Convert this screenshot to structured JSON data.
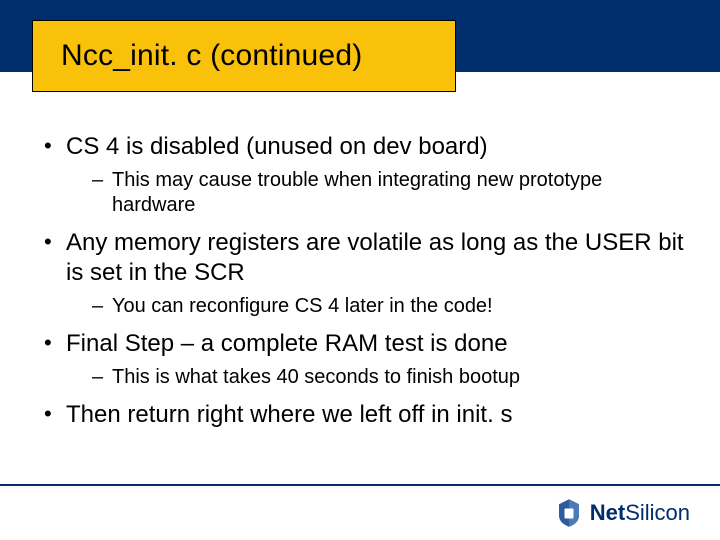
{
  "title": "Ncc_init. c (continued)",
  "bullets": [
    {
      "text": "CS 4 is disabled (unused on dev board)",
      "sub": [
        "This may cause trouble when integrating new prototype hardware"
      ]
    },
    {
      "text": "Any memory registers are volatile as long as the USER bit is set in the SCR",
      "sub": [
        "You can reconfigure CS 4 later in the code!"
      ]
    },
    {
      "text": "Final Step – a complete RAM test is done",
      "sub": [
        "This is what takes 40 seconds to finish bootup"
      ]
    },
    {
      "text": "Then return right where we left off in init. s",
      "sub": []
    }
  ],
  "footer": {
    "brand_bold": "Net",
    "brand_light": "Silicon"
  }
}
